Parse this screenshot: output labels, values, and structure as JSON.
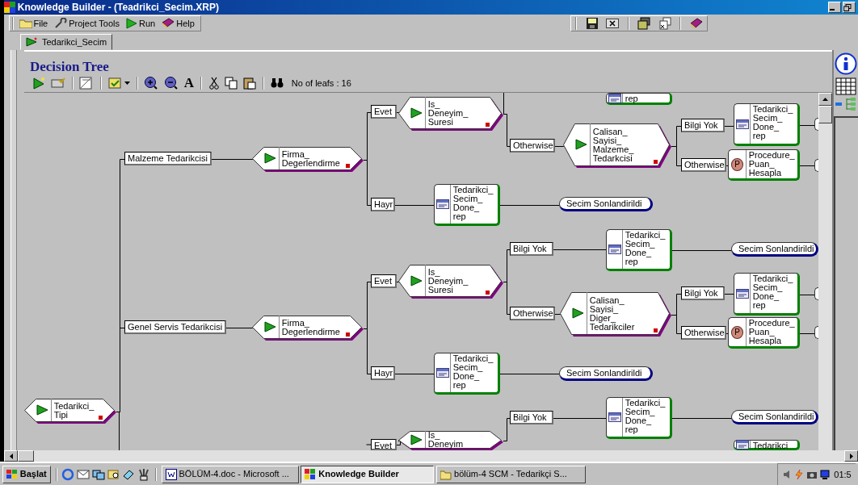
{
  "window": {
    "title": "Knowledge Builder - (Teadrikci_Secim.XRP)"
  },
  "menu": [
    {
      "label": "File"
    },
    {
      "label": "Project Tools"
    },
    {
      "label": "Run"
    },
    {
      "label": "Help"
    }
  ],
  "tabs": [
    {
      "label": "Tedarikci_Secim",
      "selected": true
    }
  ],
  "panel": {
    "title": "Decision Tree",
    "font_tool": "A",
    "leaf_count": "No of leafs : 16"
  },
  "tree": {
    "nodes": [
      {
        "kind": "report",
        "text": "rep"
      },
      {
        "kind": "label",
        "text": "Evet"
      },
      {
        "kind": "decision",
        "text": "Is_\nDeneyim_\nSuresi"
      },
      {
        "kind": "label",
        "text": "Bilgi Yok"
      },
      {
        "kind": "report",
        "text": "Tedarikci_\nSecim_\nDone_\nrep"
      },
      {
        "kind": "terminal-cut"
      },
      {
        "kind": "label",
        "text": "Otherwise"
      },
      {
        "kind": "label",
        "text": "Malzeme Tedarikcisi"
      },
      {
        "kind": "decision",
        "text": "Firma_\nDegerlendirme"
      },
      {
        "kind": "decision",
        "text": "Calisan_\nSayisi_\nMalzeme_\nTedarkcisi"
      },
      {
        "kind": "label",
        "text": "Otherwise"
      },
      {
        "kind": "procedure",
        "badge": "P",
        "text": "Procedure_\nPuan_\nHesapla"
      },
      {
        "kind": "terminal-cut"
      },
      {
        "kind": "label",
        "text": "Hayr"
      },
      {
        "kind": "report",
        "text": "Tedarikci_\nSecim_\nDone_\nrep"
      },
      {
        "kind": "terminal",
        "text": "Secim Sonlandirildi"
      },
      {
        "kind": "label",
        "text": "Bilgi Yok"
      },
      {
        "kind": "report",
        "text": "Tedarikci_\nSecim_\nDone_\nrep"
      },
      {
        "kind": "terminal",
        "text": "Secim Sonlandirildi"
      },
      {
        "kind": "label",
        "text": "Evet"
      },
      {
        "kind": "decision",
        "text": "Is_\nDeneyim_\nSuresi"
      },
      {
        "kind": "label",
        "text": "Bilgi Yok"
      },
      {
        "kind": "report",
        "text": "Tedarikci_\nSecim_\nDone_\nrep"
      },
      {
        "kind": "terminal-cut"
      },
      {
        "kind": "label",
        "text": "Otherwise"
      },
      {
        "kind": "label",
        "text": "Genel Servis Tedarikcisi"
      },
      {
        "kind": "decision",
        "text": "Firma_\nDegerlendirme"
      },
      {
        "kind": "decision",
        "text": "Calisan_\nSayisi_\nDiger_\nTedarikciler"
      },
      {
        "kind": "label",
        "text": "Otherwise"
      },
      {
        "kind": "procedure",
        "badge": "P",
        "text": "Procedure_\nPuan_\nHesapla"
      },
      {
        "kind": "terminal-cut"
      },
      {
        "kind": "label",
        "text": "Hayr"
      },
      {
        "kind": "report",
        "text": "Tedarikci_\nSecim_\nDone_\nrep"
      },
      {
        "kind": "terminal",
        "text": "Secim Sonlandirildi"
      },
      {
        "kind": "decision",
        "text": "Tedarikci_\nTipi"
      },
      {
        "kind": "label",
        "text": "Bilgi Yok"
      },
      {
        "kind": "report",
        "text": "Tedarikci_\nSecim_\nDone_\nrep"
      },
      {
        "kind": "terminal",
        "text": "Secim Sonlandirildi"
      },
      {
        "kind": "label",
        "text": "Evet"
      },
      {
        "kind": "decision",
        "text": "Is_\nDeneyim"
      },
      {
        "kind": "report",
        "text": "Tedarikci"
      }
    ]
  },
  "taskbar": {
    "start": "Başlat",
    "tasks": [
      {
        "label": "BÖLÜM-4.doc - Microsoft ...",
        "selected": false
      },
      {
        "label": "Knowledge Builder",
        "selected": true
      },
      {
        "label": "bölüm-4 SCM - Tedarikçi S...",
        "selected": false
      }
    ],
    "clock": "01:5"
  }
}
